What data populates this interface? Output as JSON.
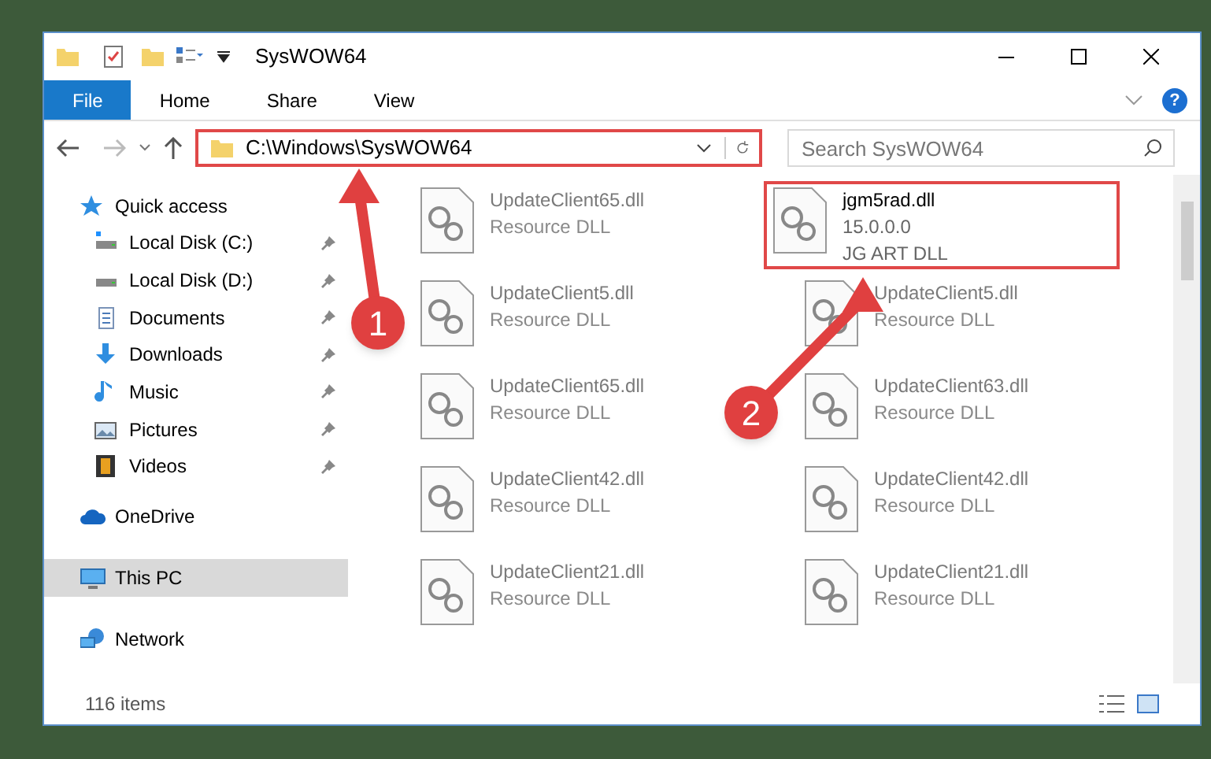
{
  "window": {
    "title": "SysWOW64"
  },
  "ribbon_tabs": [
    {
      "label": "File",
      "selected": true
    },
    {
      "label": "Home",
      "selected": false
    },
    {
      "label": "Share",
      "selected": false
    },
    {
      "label": "View",
      "selected": false
    }
  ],
  "address_bar": {
    "path": "C:\\Windows\\SysWOW64",
    "highlighted": true
  },
  "search": {
    "placeholder": "Search SysWOW64"
  },
  "sidebar": {
    "items": [
      {
        "label": "Quick access",
        "selected": false,
        "children": [
          {
            "label": "Local Disk (C:)",
            "pinned": true,
            "selected": false
          },
          {
            "label": "Local Disk (D:)",
            "pinned": true,
            "selected": false
          },
          {
            "label": "Documents",
            "pinned": true,
            "selected": false
          },
          {
            "label": "Downloads",
            "pinned": true,
            "selected": false
          },
          {
            "label": "Music",
            "pinned": true,
            "selected": false
          },
          {
            "label": "Pictures",
            "pinned": true,
            "selected": false
          },
          {
            "label": "Videos",
            "pinned": true,
            "selected": false
          }
        ]
      },
      {
        "label": "OneDrive",
        "selected": false
      },
      {
        "label": "This PC",
        "selected": true
      },
      {
        "label": "Network",
        "selected": false
      }
    ]
  },
  "help_button": {
    "label": "?"
  },
  "files": [
    {
      "name": "UpdateClient65.dll",
      "lines": [
        "Resource DLL"
      ],
      "blurred": true,
      "highlighted": false
    },
    {
      "name": "jgm5rad.dll",
      "lines": [
        "15.0.0.0",
        "JG ART DLL"
      ],
      "blurred": false,
      "highlighted": true
    },
    {
      "name": "UpdateClient5.dll",
      "lines": [
        "Resource DLL"
      ],
      "blurred": true,
      "highlighted": false
    },
    {
      "name": "UpdateClient5.dll",
      "lines": [
        "Resource DLL"
      ],
      "blurred": true,
      "highlighted": false
    },
    {
      "name": "UpdateClient65.dll",
      "lines": [
        "Resource DLL"
      ],
      "blurred": true,
      "highlighted": false
    },
    {
      "name": "UpdateClient63.dll",
      "lines": [
        "Resource DLL"
      ],
      "blurred": true,
      "highlighted": false
    },
    {
      "name": "UpdateClient42.dll",
      "lines": [
        "Resource DLL"
      ],
      "blurred": true,
      "highlighted": false
    },
    {
      "name": "UpdateClient42.dll",
      "lines": [
        "Resource DLL"
      ],
      "blurred": true,
      "highlighted": false
    },
    {
      "name": "UpdateClient21.dll",
      "lines": [
        "Resource DLL"
      ],
      "blurred": true,
      "highlighted": false
    },
    {
      "name": "UpdateClient21.dll",
      "lines": [
        "Resource DLL"
      ],
      "blurred": true,
      "highlighted": false
    }
  ],
  "annotations": [
    {
      "number": "1"
    },
    {
      "number": "2"
    }
  ],
  "status_bar": {
    "count": "116 items"
  }
}
